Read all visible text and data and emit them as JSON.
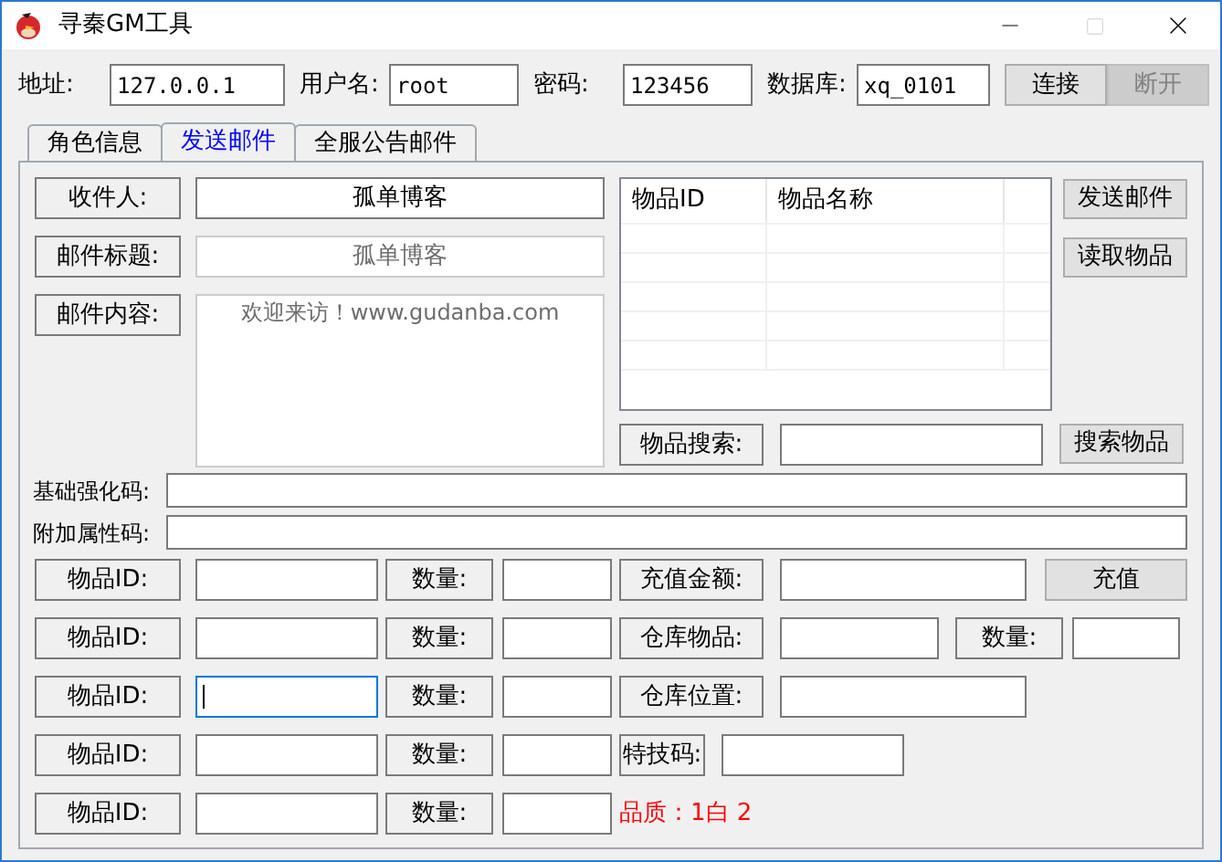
{
  "window": {
    "title": "寻秦GM工具"
  },
  "connection": {
    "fields": [
      {
        "label": "地址:",
        "value": "127.0.0.1"
      },
      {
        "label": "用户名:",
        "value": "root"
      },
      {
        "label": "密码:",
        "value": "123456"
      },
      {
        "label": "数据库:",
        "value": "xq_0101"
      }
    ],
    "buttons": [
      {
        "label": "连接",
        "disabled": false
      },
      {
        "label": "断开",
        "disabled": true
      }
    ]
  },
  "tabs": [
    {
      "label": "角色信息",
      "selected": false
    },
    {
      "label": "发送邮件",
      "selected": true
    },
    {
      "label": "全服公告邮件",
      "selected": false
    }
  ],
  "mail": {
    "recipient": {
      "label": "收件人:",
      "value": "孤单博客",
      "disabled": false
    },
    "subject": {
      "label": "邮件标题:",
      "value": "孤单博客",
      "disabled": true
    },
    "content": {
      "label": "邮件内容:",
      "value": "欢迎来访！www.gudanba.com",
      "disabled": true
    }
  },
  "items_table": {
    "columns": [
      "物品ID",
      "物品名称"
    ]
  },
  "side_buttons": [
    "发送邮件",
    "读取物品"
  ],
  "search": {
    "label": "物品搜索:",
    "button": "搜索物品"
  },
  "codes": [
    {
      "label": "基础强化码:"
    },
    {
      "label": "附加属性码:"
    }
  ],
  "item_rows": [
    {
      "id_label": "物品ID:",
      "qty_label": "数量:",
      "focused": false
    },
    {
      "id_label": "物品ID:",
      "qty_label": "数量:",
      "focused": false
    },
    {
      "id_label": "物品ID:",
      "qty_label": "数量:",
      "focused": true
    },
    {
      "id_label": "物品ID:",
      "qty_label": "数量:",
      "focused": false
    },
    {
      "id_label": "物品ID:",
      "qty_label": "数量:",
      "focused": false
    }
  ],
  "right_rows": [
    {
      "kind": "recharge",
      "label": "充值金额:",
      "button": "充值"
    },
    {
      "kind": "warehouse",
      "label": "仓库物品:",
      "qty_label": "数量:"
    },
    {
      "kind": "field",
      "label": "仓库位置:"
    },
    {
      "kind": "skill",
      "label": "特技码:"
    },
    {
      "kind": "note",
      "text": "品质：1白 2"
    }
  ]
}
